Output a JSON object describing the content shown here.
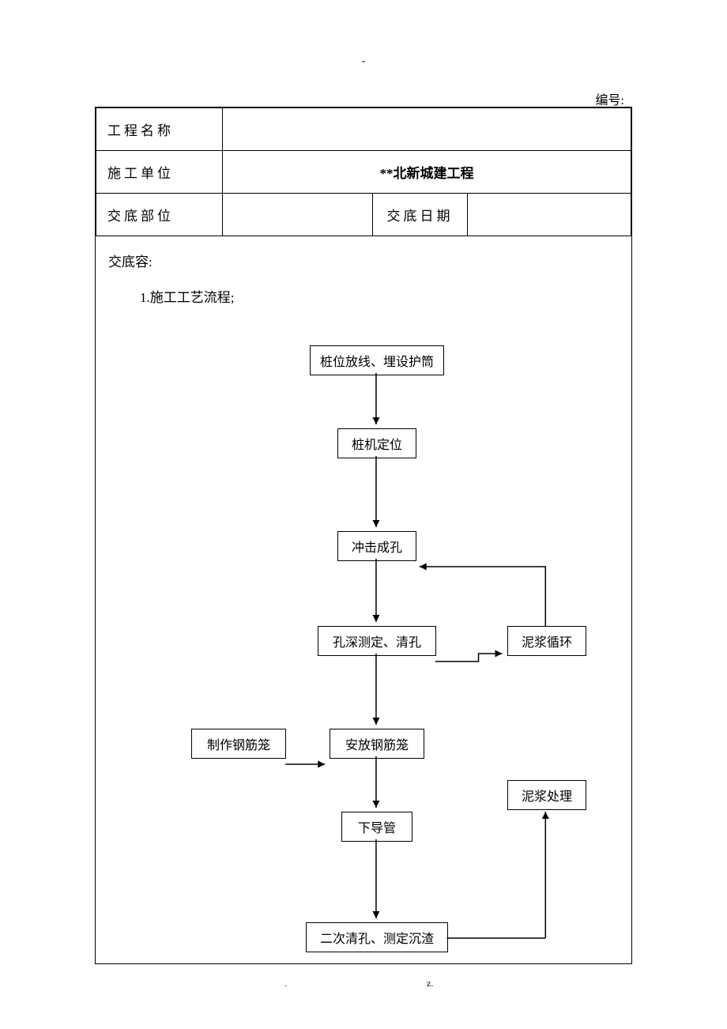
{
  "top_dash": "-",
  "serial_label": "编号:",
  "table": {
    "row1_label": "工程名称",
    "row1_value": "",
    "row2_label": "施工单位",
    "row2_value": "**北新城建工程",
    "row3_label": "交底部位",
    "row3_mid": "",
    "row3_date_label": "交底日期",
    "row3_date_value": ""
  },
  "content": {
    "title": "交底容:",
    "sub": "1.施工工艺流程;"
  },
  "nodes": {
    "n1": "桩位放线、埋设护筒",
    "n2": "桩机定位",
    "n3": "冲击成孔",
    "n4": "孔深测定、清孔",
    "n5": "安放钢筋笼",
    "n6": "下导管",
    "n7": "二次清孔、测定沉渣",
    "side_left": "制作钢筋笼",
    "side_r1": "泥浆循环",
    "side_r2": "泥浆处理"
  },
  "footer": {
    "dot": ".",
    "z": "z."
  }
}
